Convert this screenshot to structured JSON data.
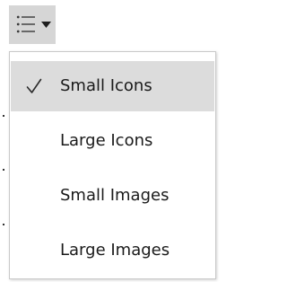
{
  "toolbar": {
    "view_button": {
      "icon": "list-icon",
      "dropdown_icon": "caret-down-icon"
    }
  },
  "menu": {
    "items": [
      {
        "label": "Small Icons",
        "selected": true,
        "icon": "check-icon"
      },
      {
        "label": "Large Icons",
        "selected": false
      },
      {
        "label": "Small Images",
        "selected": false
      },
      {
        "label": "Large Images",
        "selected": false
      }
    ]
  },
  "colors": {
    "button_bg": "#d6d6d6",
    "selected_bg": "#dcdcdc",
    "text": "#1a1a1a",
    "menu_border": "#c9c9c9"
  }
}
